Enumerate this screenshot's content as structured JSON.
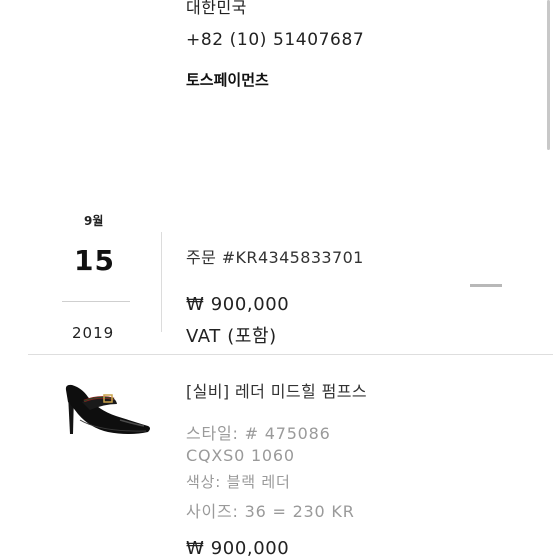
{
  "address": {
    "country": "대한민국",
    "phone": "+82 (10) 51407687",
    "payment_method": "토스페이먼츠"
  },
  "order": {
    "month": "9월",
    "day": "15",
    "year": "2019",
    "number": "주문 #KR4345833701",
    "total": "₩ 900,000",
    "vat": "VAT (포함)"
  },
  "item": {
    "name": "[실비] 레더 미드힐 펌프스",
    "style": "스타일: # 475086",
    "code": "CQXS0 1060",
    "color": "색상: 블랙 레더",
    "size": "사이즈: 36 = 230 KR",
    "price": "₩ 900,000",
    "image_icon": "shoe-icon"
  },
  "colors": {
    "text": "#1b1b1b",
    "muted": "#9a9a9a",
    "divider": "#dedede"
  }
}
